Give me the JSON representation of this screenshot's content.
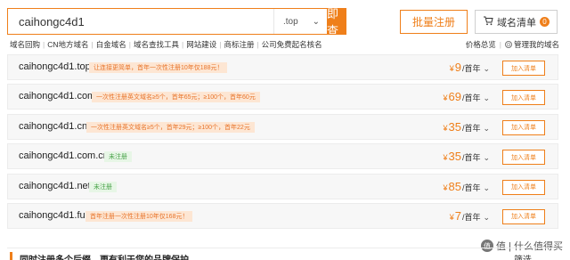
{
  "search": {
    "query": "caihongc4d1",
    "suffix": ".top",
    "button": "立即查询"
  },
  "actions": {
    "batch_register": "批量注册",
    "cart_label": "域名清单",
    "cart_count": "0"
  },
  "navlinks": [
    "域名回购",
    "CN地方域名",
    "白金域名",
    "域名查找工具",
    "网站建设",
    "商标注册",
    "公司免费起名核名"
  ],
  "rightlinks": {
    "price_desc": "价格总览",
    "manage": "管理我的域名"
  },
  "domains": [
    {
      "name": "caihongc4d1.top",
      "tag": "让连接更简单，首年一次性注册10年仅188元！",
      "price": "9",
      "unit": "/首年",
      "add": "加入清单"
    },
    {
      "name": "caihongc4d1.com",
      "tag": "一次性注册英文域名≥5个，首年65元；≥100个，首年60元",
      "price": "69",
      "unit": "/首年",
      "add": "加入清单"
    },
    {
      "name": "caihongc4d1.cn",
      "tag": "一次性注册英文域名≥5个，首年29元；≥100个，首年22元",
      "price": "35",
      "unit": "/首年",
      "add": "加入清单"
    },
    {
      "name": "caihongc4d1.com.cn",
      "tag": "未注册",
      "price": "35",
      "unit": "/首年",
      "add": "加入清单"
    },
    {
      "name": "caihongc4d1.net",
      "tag": "未注册",
      "price": "85",
      "unit": "/首年",
      "add": "加入清单"
    },
    {
      "name": "caihongc4d1.fun",
      "tag": "首年注册一次性注册10年仅168元！",
      "price": "7",
      "unit": "/首年",
      "add": "加入清单"
    }
  ],
  "currency": "¥",
  "bottom": {
    "title": "同时注册多个后缀，更有利于您的品牌保护",
    "filter": "筛选"
  },
  "watermark": "值 | 什么值得买",
  "colors": {
    "accent": "#ef7f1a",
    "promo_bg": "#fde6d3",
    "green_text": "#4aa34a"
  }
}
